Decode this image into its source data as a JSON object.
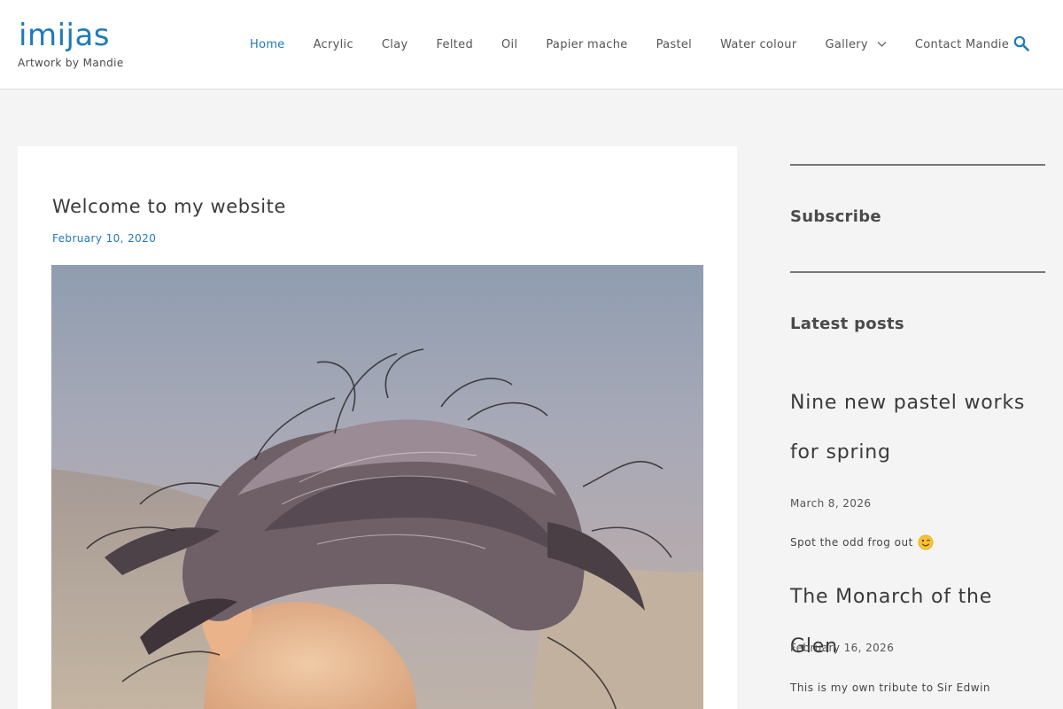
{
  "site": {
    "title": "imijas",
    "tagline": "Artwork by Mandie"
  },
  "nav": {
    "items": [
      {
        "label": "Home",
        "active": true
      },
      {
        "label": "Acrylic"
      },
      {
        "label": "Clay"
      },
      {
        "label": "Felted"
      },
      {
        "label": "Oil"
      },
      {
        "label": "Papier mache"
      },
      {
        "label": "Pastel"
      },
      {
        "label": "Water colour"
      },
      {
        "label": "Gallery",
        "has_dropdown": true
      },
      {
        "label": "Contact Mandie"
      }
    ],
    "search_icon": "search-icon"
  },
  "post": {
    "title": "Welcome to my website",
    "date": "February 10, 2020",
    "image_subject": "watercolour painting of windswept hair"
  },
  "sidebar": {
    "subscribe_title": "Subscribe",
    "latest_title": "Latest posts",
    "posts": [
      {
        "title_line1": "Nine new pastel works",
        "title_line2": "for spring",
        "date": "March 8, 2026",
        "excerpt": "Spot the odd frog out",
        "emoji": "winking-face-emoji"
      },
      {
        "title_line1": "The Monarch of the Glen",
        "date": "February 16, 2026",
        "excerpt": "This is my own tribute to Sir Edwin"
      }
    ]
  },
  "colors": {
    "accent": "#1f7ab8",
    "background": "#f4f4f4",
    "text": "#3a3a3a"
  }
}
